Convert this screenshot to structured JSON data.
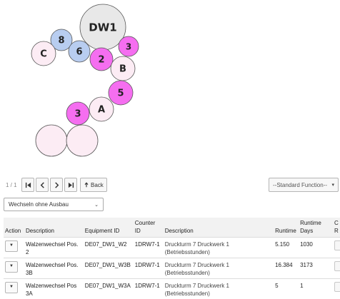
{
  "diagram": {
    "circles": [
      {
        "label": "DW1",
        "style": "grey"
      },
      {
        "label": "8",
        "style": "blue"
      },
      {
        "label": "6",
        "style": "blue"
      },
      {
        "label": "C",
        "style": "pale"
      },
      {
        "label": "2",
        "style": "magenta"
      },
      {
        "label": "3",
        "style": "magenta"
      },
      {
        "label": "B",
        "style": "pale"
      },
      {
        "label": "5",
        "style": "magenta"
      },
      {
        "label": "A",
        "style": "pale"
      },
      {
        "label": "3",
        "style": "magenta"
      },
      {
        "label": "",
        "style": "pale"
      },
      {
        "label": "",
        "style": "pale"
      }
    ],
    "colors": {
      "grey": "#e8e8e8",
      "blue": "#b8cdf0",
      "magenta": "#f56ef0",
      "pale": "#fcecf4",
      "stroke": "#555555"
    }
  },
  "pager": {
    "page_count": "1 / 1",
    "back_label": "Back"
  },
  "standard_function": {
    "label": "--Standard Function--"
  },
  "filter_select": {
    "value": "Wechseln ohne Ausbau"
  },
  "table": {
    "headers": {
      "action": "Action",
      "description": "Description",
      "equipment_id": "Equipment ID",
      "counter_id_1": "Counter",
      "counter_id_2": "ID",
      "description2": "Description",
      "runtime": "Runtime",
      "runtime_days_1": "Runtime",
      "runtime_days_2": "Days",
      "extra_1": "C",
      "extra_2": "R"
    },
    "rows": [
      {
        "description": "Walzenwechsel Pos. 2",
        "description_2": "",
        "equipment_id": "DE07_DW1_W2",
        "counter_id": "1DRW7-1",
        "counter_desc_1": "Druckturm 7 Druckwerk 1",
        "counter_desc_2": "(Betriebsstunden)",
        "runtime": "5.150",
        "runtime_days": "1030"
      },
      {
        "description": "Walzenwechsel Pos.",
        "description_2": "3B",
        "equipment_id": "DE07_DW1_W3B",
        "counter_id": "1DRW7-1",
        "counter_desc_1": "Druckturm 7 Druckwerk 1",
        "counter_desc_2": "(Betriebsstunden)",
        "runtime": "16.384",
        "runtime_days": "3173"
      },
      {
        "description": "Walzenwechsel Pos",
        "description_2": "3A",
        "equipment_id": "DE07_DW1_W3A",
        "counter_id": "1DRW7-1",
        "counter_desc_1": "Druckturm 7 Druckwerk 1",
        "counter_desc_2": "(Betriebsstunden)",
        "runtime": "5",
        "runtime_days": "1"
      }
    ]
  }
}
